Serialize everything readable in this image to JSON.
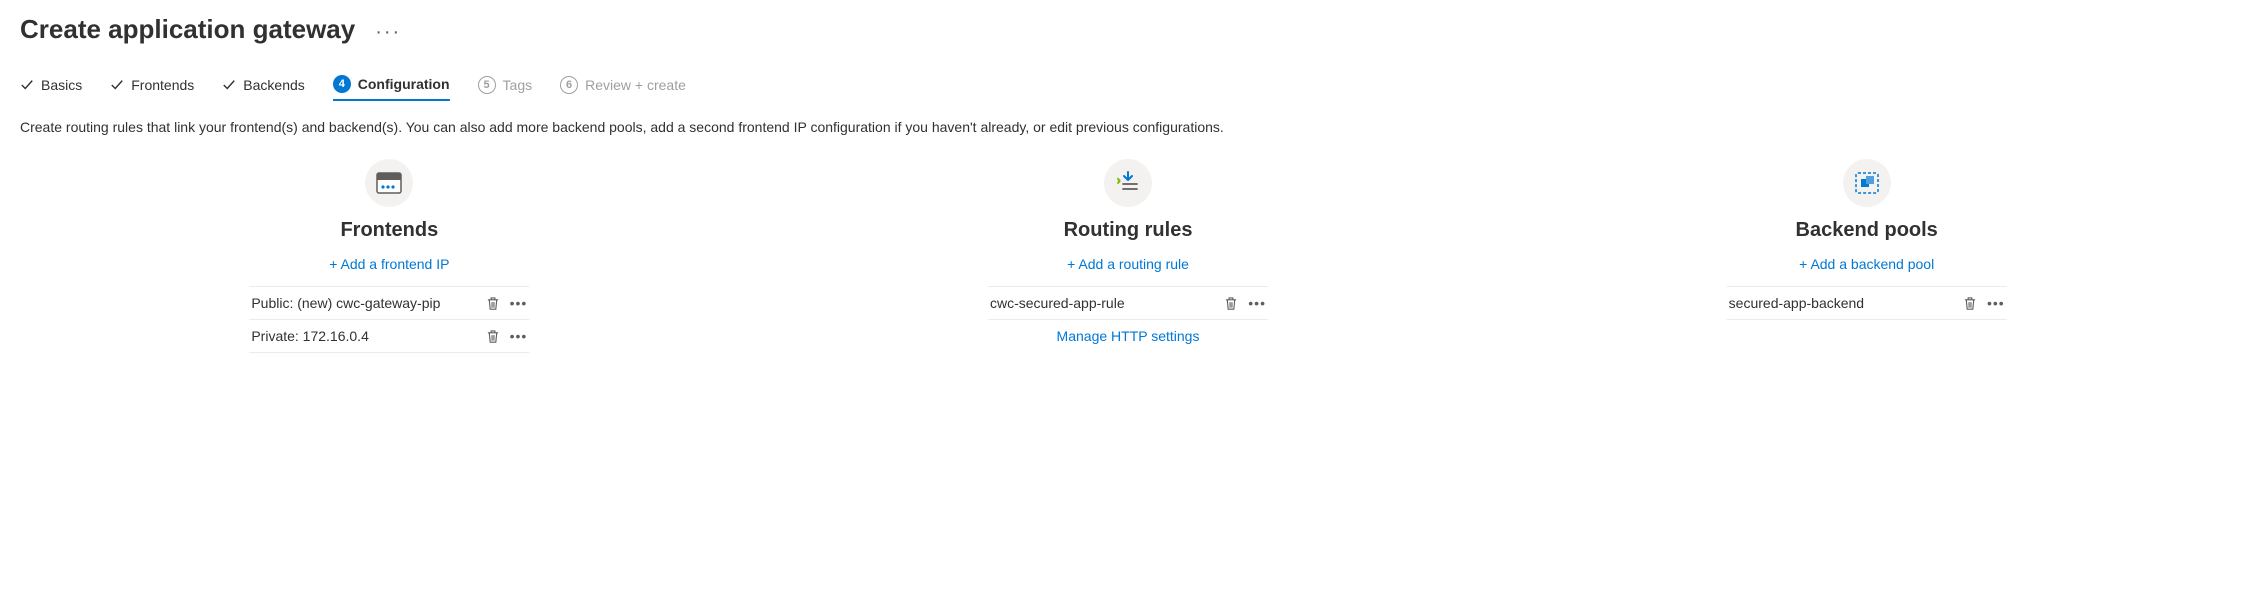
{
  "page_title": "Create application gateway",
  "tabs": {
    "basics": "Basics",
    "frontends": "Frontends",
    "backends": "Backends",
    "configuration": {
      "num": "4",
      "label": "Configuration"
    },
    "tags": {
      "num": "5",
      "label": "Tags"
    },
    "review": {
      "num": "6",
      "label": "Review + create"
    }
  },
  "description": "Create routing rules that link your frontend(s) and backend(s). You can also add more backend pools, add a second frontend IP configuration if you haven't already, or edit previous configurations.",
  "columns": {
    "frontends": {
      "title": "Frontends",
      "add_label": "Add a frontend IP",
      "items": [
        {
          "label": "Public: (new) cwc-gateway-pip"
        },
        {
          "label": "Private: 172.16.0.4"
        }
      ]
    },
    "routing": {
      "title": "Routing rules",
      "add_label": "Add a routing rule",
      "items": [
        {
          "label": "cwc-secured-app-rule"
        }
      ],
      "manage_link": "Manage HTTP settings"
    },
    "backends": {
      "title": "Backend pools",
      "add_label": "Add a backend pool",
      "items": [
        {
          "label": "secured-app-backend"
        }
      ]
    }
  }
}
